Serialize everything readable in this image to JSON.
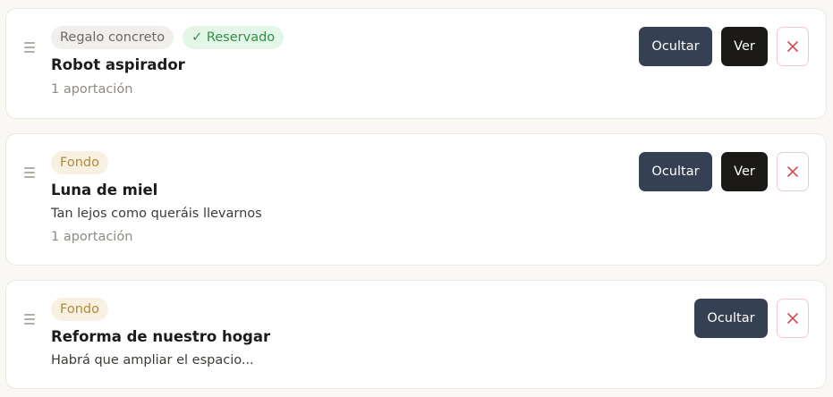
{
  "items": [
    {
      "type_label": "Regalo concreto",
      "status_label": "✓ Reservado",
      "title": "Robot aspirador",
      "contributions": "1 aportación",
      "hide_label": "Ocultar",
      "view_label": "Ver"
    },
    {
      "type_label": "Fondo",
      "title": "Luna de miel",
      "description": "Tan lejos como queráis llevarnos",
      "contributions": "1 aportación",
      "hide_label": "Ocultar",
      "view_label": "Ver"
    },
    {
      "type_label": "Fondo",
      "title": "Reforma de nuestro hogar",
      "description": "Habrá que ampliar el espacio...",
      "hide_label": "Ocultar"
    }
  ],
  "icons": {
    "drag": "drag-handle-icon",
    "delete": "close-icon"
  },
  "colors": {
    "hide_button": "#354052",
    "view_button": "#1c1a17",
    "delete_accent": "#d04a55",
    "reserved_badge_text": "#2f8f47",
    "fund_badge_text": "#b08a3a"
  }
}
